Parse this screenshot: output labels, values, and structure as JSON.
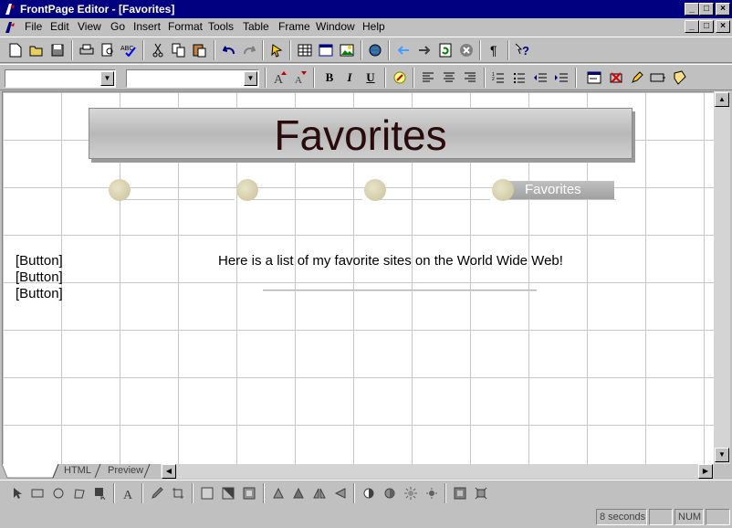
{
  "window": {
    "title": "FrontPage Editor - [Favorites]",
    "caption_buttons": [
      "_",
      "□",
      "×"
    ],
    "mdi_buttons": [
      "_",
      "□",
      "×"
    ]
  },
  "menu": [
    {
      "label": "File",
      "key": "F"
    },
    {
      "label": "Edit",
      "key": "E"
    },
    {
      "label": "View",
      "key": "V"
    },
    {
      "label": "Go",
      "key": "G"
    },
    {
      "label": "Insert",
      "key": "I"
    },
    {
      "label": "Format",
      "key": "o"
    },
    {
      "label": "Tools",
      "key": "T"
    },
    {
      "label": "Table",
      "key": "a"
    },
    {
      "label": "Frame",
      "key": "r"
    },
    {
      "label": "Window",
      "key": "W"
    },
    {
      "label": "Help",
      "key": "H"
    }
  ],
  "format_toolbar": {
    "style_value": "",
    "font_value": "",
    "bold": "B",
    "italic": "I",
    "underline": "U"
  },
  "page": {
    "banner_title": "Favorites",
    "nav_active_label": "Favorites",
    "button_labels": [
      "[Button]",
      "[Button]",
      "[Button]"
    ],
    "intro_text": "Here is a list of my favorite sites on the World Wide Web!"
  },
  "tabs": {
    "normal": "",
    "html": "HTML",
    "preview": "Preview"
  },
  "status": {
    "message": "",
    "time": "8 seconds",
    "mode": "",
    "num": "NUM"
  },
  "colors": {
    "titlebar": "#000080",
    "chrome": "#c0c0c0",
    "banner_text": "#2a0a0a"
  }
}
